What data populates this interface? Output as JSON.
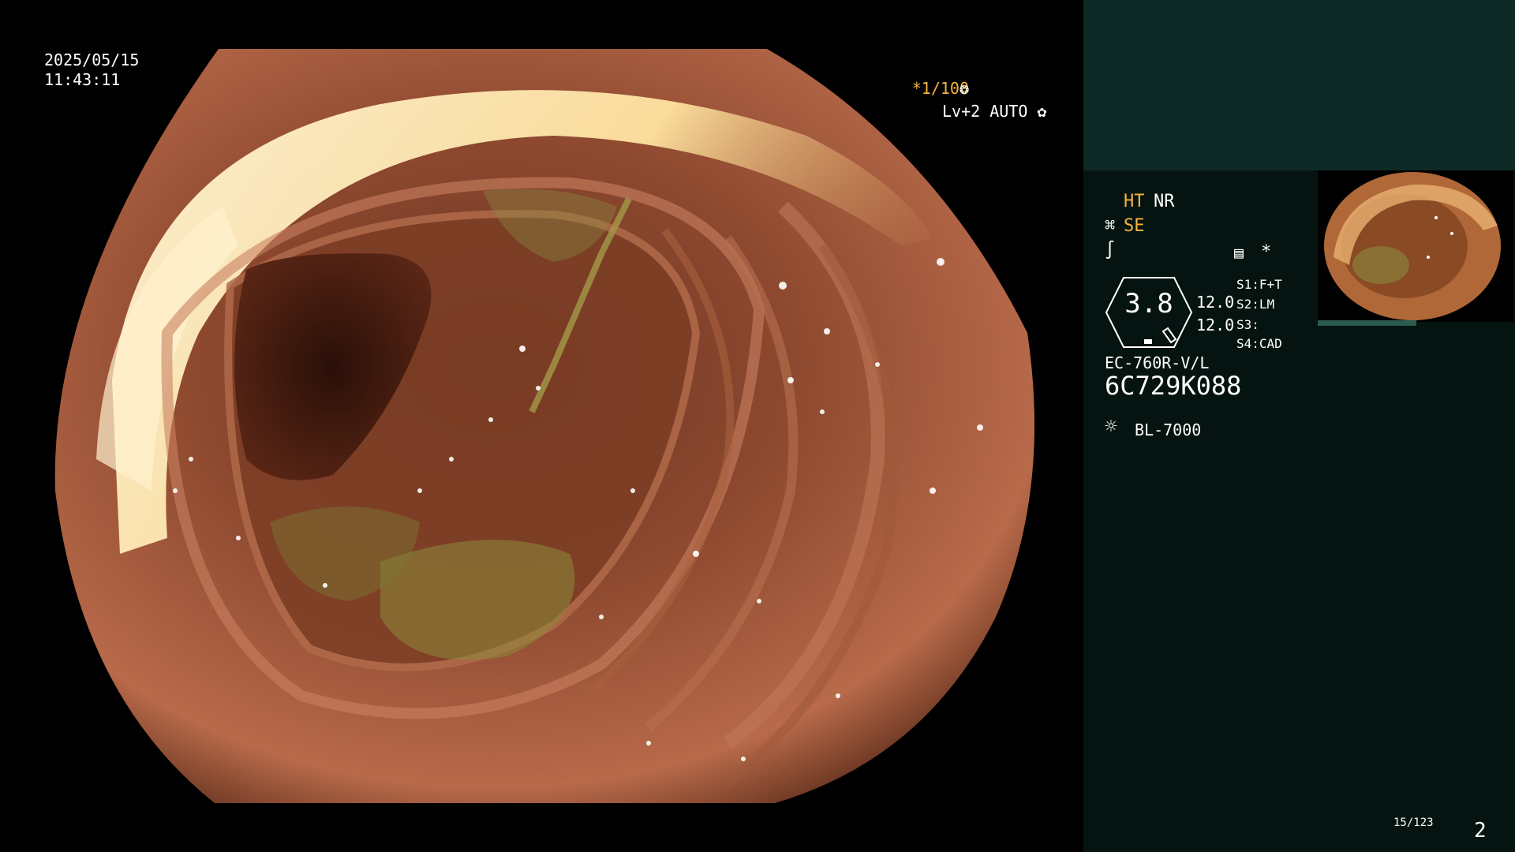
{
  "overlay": {
    "date": "2025/05/15",
    "time": "11:43:11",
    "shutter": "*1/100",
    "shutter_icon": "aperture-icon",
    "iris": "Lv+2 AUTO",
    "iris_icon": "iris-icon"
  },
  "panel": {
    "ht": "HT",
    "nr": "NR",
    "se": "SE",
    "se_icon": "enhance-icon",
    "struct_icon": "structure-icon",
    "doc_icon": "document-icon",
    "star": "*",
    "hex_value": "3.8",
    "num1": "12.0",
    "num2": "12.0",
    "switches": {
      "s1": "S1:F+T",
      "s2": "S2:LM",
      "s3": "S3:",
      "s4": "S4:CAD"
    },
    "model": "EC-760R-V/L",
    "serial": "6C729K088",
    "light_icon": "lamp-icon",
    "light": "BL-7000",
    "counter": "15/123",
    "page": "2"
  },
  "colors": {
    "accent": "#f4b43c",
    "panel_bg": "#061411",
    "panel_top": "#0f2a26"
  }
}
